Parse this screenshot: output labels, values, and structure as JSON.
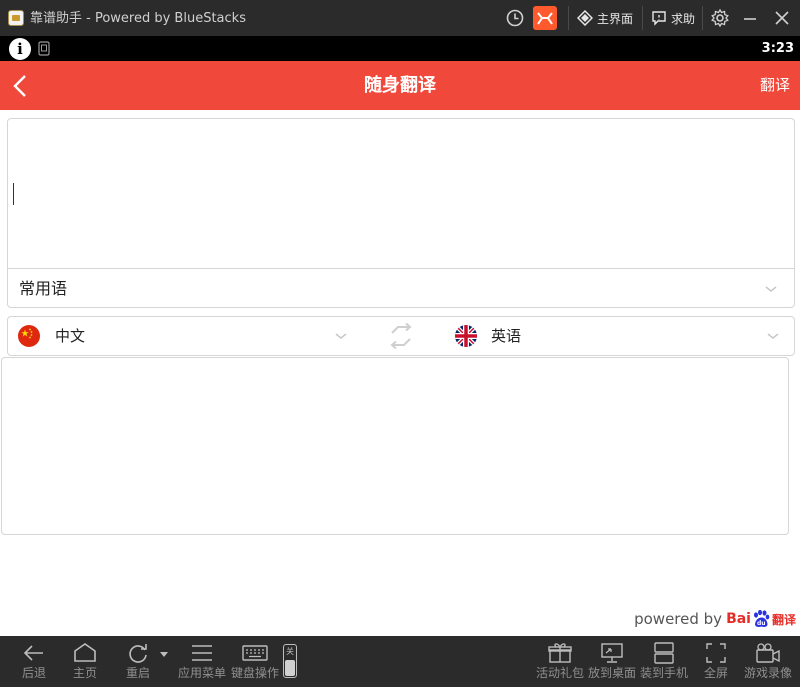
{
  "window": {
    "title": "靠谱助手 - Powered by BlueStacks",
    "home_label": "主界面",
    "help_label": "求助"
  },
  "status_bar": {
    "time": "3:23"
  },
  "app_bar": {
    "title": "随身翻译",
    "translate_label": "翻译"
  },
  "input": {
    "source_text": "",
    "common_phrases_label": "常用语"
  },
  "languages": {
    "source": "中文",
    "target": "英语"
  },
  "output": {
    "translated_text": ""
  },
  "footer": {
    "powered_text": "powered by",
    "brand_bai": "Bai",
    "brand_fanyi": "翻译"
  },
  "toolbar": {
    "back": "后退",
    "home": "主页",
    "restart": "重启",
    "app_menu": "应用菜单",
    "keyboard": "键盘操作",
    "keyboard_toggle": "关",
    "gifts": "活动礼包",
    "to_desktop": "放到桌面",
    "to_phone": "装到手机",
    "fullscreen": "全屏",
    "record": "游戏录像"
  },
  "colors": {
    "accent": "#f0493b",
    "titlebar": "#2b2b2b",
    "statusbar": "#000000"
  }
}
